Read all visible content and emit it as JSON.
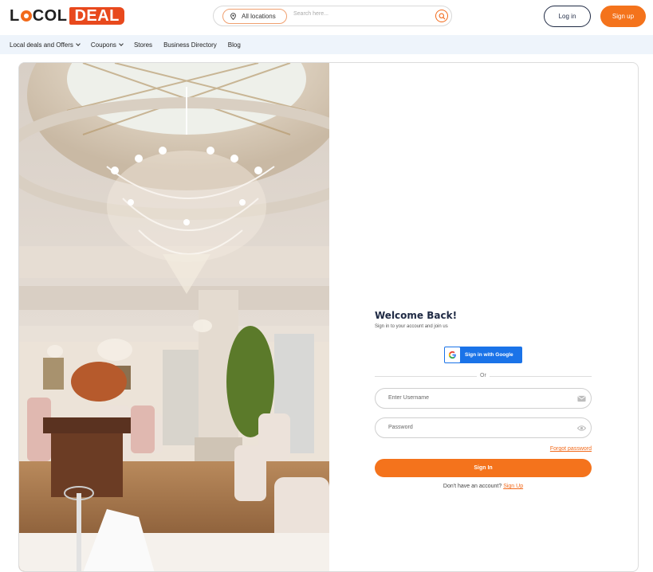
{
  "brand": {
    "logo_lo": "LOC",
    "logo_l": "L",
    "logo_deal": "DEAL",
    "accent": "#f4731c"
  },
  "search": {
    "location_label": "All locations",
    "placeholder": "Search here..."
  },
  "header": {
    "login_label": "Log in",
    "signup_label": "Sign up"
  },
  "nav": {
    "items": [
      {
        "label": "Local deals and Offers",
        "dropdown": true
      },
      {
        "label": "Coupons",
        "dropdown": true
      },
      {
        "label": "Stores",
        "dropdown": false
      },
      {
        "label": "Business Directory",
        "dropdown": false
      },
      {
        "label": "Blog",
        "dropdown": false
      }
    ]
  },
  "login_form": {
    "title": "Welcome Back!",
    "subtitle": "Sign in to your account and join us",
    "google_label": "Sign in with Google",
    "or_label": "Or",
    "username_placeholder": "Enter Username",
    "password_placeholder": "Password",
    "forgot_label": "Forgot password",
    "signin_label": "Sign In",
    "no_account_text": "Don't have an account?",
    "signup_link": "Sign Up"
  }
}
